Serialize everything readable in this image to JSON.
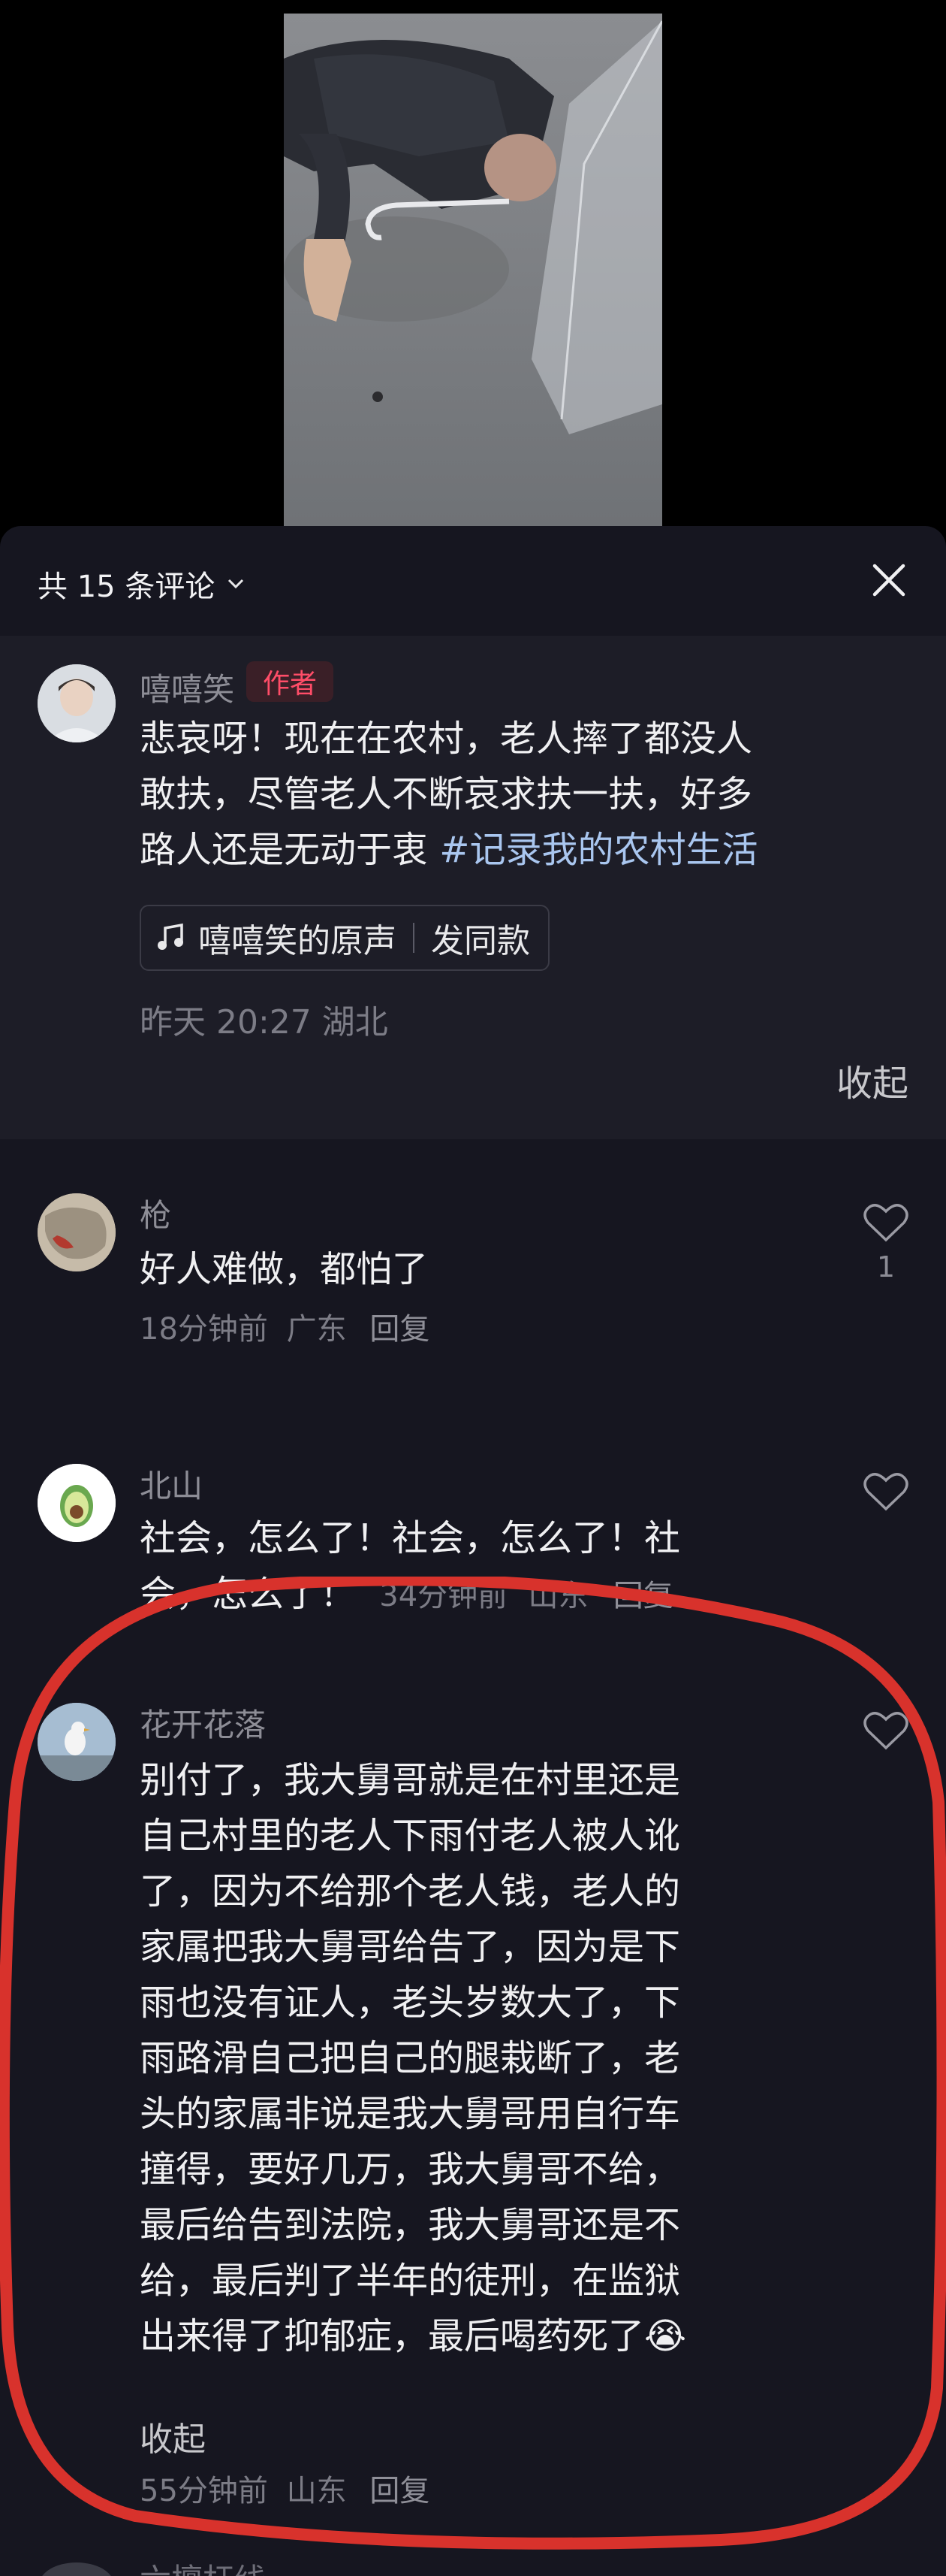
{
  "header": {
    "title": "共 15 条评论",
    "close_icon": "close-icon",
    "dropdown_icon": "chevron-down-icon"
  },
  "author_comment": {
    "username": "嘻嘻笑",
    "author_tag": "作者",
    "text_line1": "悲哀呀！现在在农村，老人摔了都没人",
    "text_line2": "敢扶，尽管老人不断哀求扶一扶，好多",
    "text_line3_plain": "路人还是无动于衷 ",
    "hashtag": "#记录我的农村生活",
    "sound_label": "嘻嘻笑的原声",
    "same_style_label": "发同款",
    "time_location": "昨天 20:27 湖北",
    "collapse_label": "收起"
  },
  "comments": [
    {
      "username": "枪",
      "text": "好人难做，都怕了",
      "time": "18分钟前",
      "location": "广东",
      "reply_label": "回复",
      "like_count": "1"
    },
    {
      "username": "北山",
      "text_line1": "社会，怎么了！社会，怎么了！社",
      "text_line2": "会，怎么了！",
      "time": "34分钟前",
      "location": "山东",
      "reply_label": "回复"
    },
    {
      "username": "花开花落",
      "lines": [
        "别付了，我大舅哥就是在村里还是",
        "自己村里的老人下雨付老人被人讹",
        "了，因为不给那个老人钱，老人的",
        "家属把我大舅哥给告了，因为是下",
        "雨也没有证人，老头岁数大了，下",
        "雨路滑自己把自己的腿栽断了，老",
        "头的家属非说是我大舅哥用自行车",
        "撞得，要好几万，我大舅哥不给，",
        "最后给告到法院，我大舅哥还是不",
        "给，最后判了半年的徒刑，在监狱",
        "出来得了抑郁症，最后喝药死了😭"
      ],
      "collapse_label": "收起",
      "time": "55分钟前",
      "location": "山东",
      "reply_label": "回复"
    }
  ],
  "next_comment_peek": "六檀杆线",
  "colors": {
    "sheet_bg": "#161620",
    "author_bg": "#1d1d27",
    "author_tag_text": "#ff4d68",
    "hashtag": "#a9c6ef",
    "annotation_red": "#d8322c"
  }
}
